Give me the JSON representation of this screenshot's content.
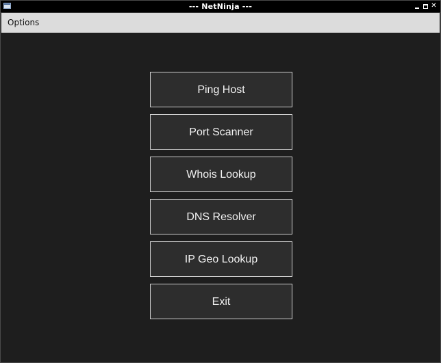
{
  "window": {
    "title": "--- NetNinja ---",
    "controls": {
      "minimize_icon": "minimize-icon",
      "maximize_icon": "maximize-icon",
      "close_icon": "close-icon",
      "close_glyph": "✕"
    }
  },
  "menubar": {
    "items": [
      {
        "label": "Options"
      }
    ]
  },
  "main": {
    "buttons": [
      {
        "label": "Ping Host"
      },
      {
        "label": "Port Scanner"
      },
      {
        "label": "Whois Lookup"
      },
      {
        "label": "DNS Resolver"
      },
      {
        "label": "IP Geo Lookup"
      },
      {
        "label": "Exit"
      }
    ]
  },
  "colors": {
    "background": "#1e1e1e",
    "button_bg": "#2d2d2d",
    "button_border": "#d0d0d0",
    "button_text": "#f2f2f2",
    "menubar_bg": "#dcdcdc",
    "titlebar_bg": "#000000"
  }
}
